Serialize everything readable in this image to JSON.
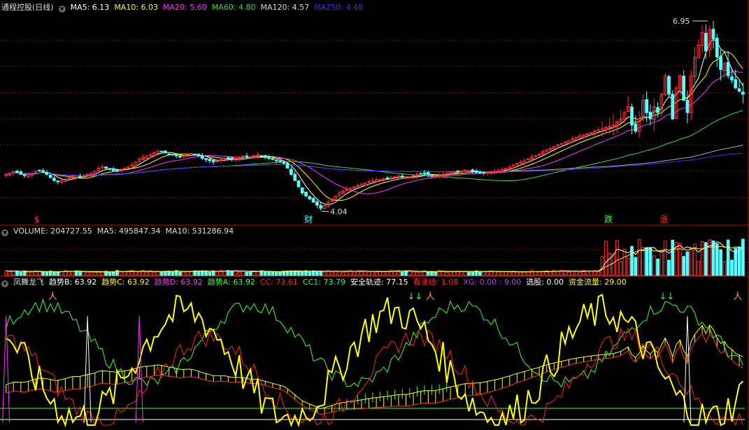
{
  "colors": {
    "background": "#000000",
    "grid": "#6a0d0d",
    "separator": "#b01010",
    "up": "#ff3030",
    "down": "#54ffff",
    "ma5": "#ffffff",
    "ma10": "#ffff00",
    "ma20": "#ff33ff",
    "ma60": "#33dd33",
    "ma120": "#aaaaaa",
    "ma250": "#3333ff",
    "trend_b": "#ffffff",
    "trend_c": "#ffff00",
    "trend_d": "#ff33ff",
    "trend_a": "#33ff33",
    "cc": "#ff2020",
    "cc1": "#33ff33",
    "safe": "#ffffff",
    "rise_line": "#ff2020",
    "xg": "#bb33ff",
    "select": "#ffffff",
    "funds": "#ffff00"
  },
  "price_panel": {
    "title": "通程控股(日线)",
    "indicators": [
      {
        "label": "MA5: 6.13",
        "color": "#ffffff"
      },
      {
        "label": "MA10: 6.03",
        "color": "#ffff00"
      },
      {
        "label": "MA20: 5.60",
        "color": "#ff33ff"
      },
      {
        "label": "MA60: 4.80",
        "color": "#33dd33"
      },
      {
        "label": "MA120: 4.57",
        "color": "#dddddd"
      },
      {
        "label": "MA250: 4.48",
        "color": "#3333ff"
      }
    ],
    "high_label": "6.95",
    "low_label": "4.04",
    "markers": [
      {
        "text": "$",
        "color": "#ff3030"
      },
      {
        "text": "财",
        "color": "#54ffff"
      },
      {
        "text": "跌",
        "color": "#33ff33"
      },
      {
        "text": "涨",
        "color": "#ff3030"
      }
    ]
  },
  "volume_panel": {
    "indicators": [
      {
        "label": "VOLUME: 204727.55",
        "color": "#dddddd"
      },
      {
        "label": "MA5: 495847.34",
        "color": "#dddddd"
      },
      {
        "label": "MA10: 531286.94",
        "color": "#dddddd"
      }
    ]
  },
  "indicator_panel": {
    "indicators": [
      {
        "label": "凤舞龙飞",
        "color": "#dddddd"
      },
      {
        "label": "趋势B: 63.92",
        "color": "#ffffff"
      },
      {
        "label": "趋势C: 63.92",
        "color": "#ffff00"
      },
      {
        "label": "趋势D: 63.92",
        "color": "#ff33ff"
      },
      {
        "label": "趋势A: 63.92",
        "color": "#33ff33"
      },
      {
        "label": "CC: 73.61",
        "color": "#ff2020"
      },
      {
        "label": "CC1: 73.79",
        "color": "#33ff33"
      },
      {
        "label": "安全轨迹: 77.15",
        "color": "#ffffff"
      },
      {
        "label": "看涨线: 1.08",
        "color": "#ff2020"
      },
      {
        "label": "XG: 0.00 : 9.00",
        "color": "#bb33ff"
      },
      {
        "label": "选股: 0.00",
        "color": "#ffffff"
      },
      {
        "label": "资金流量: 29.00",
        "color": "#ffff00"
      }
    ]
  },
  "chart_data": [
    {
      "type": "candlestick",
      "series": [
        {
          "name": "MA5",
          "value": 6.13
        },
        {
          "name": "MA10",
          "value": 6.03
        },
        {
          "name": "MA20",
          "value": 5.6
        },
        {
          "name": "MA60",
          "value": 4.8
        },
        {
          "name": "MA120",
          "value": 4.57
        },
        {
          "name": "MA250",
          "value": 4.48
        }
      ],
      "ylim": [
        3.8,
        7.2
      ],
      "bars": 205,
      "closes": [
        4.6,
        4.62,
        4.65,
        4.63,
        4.6,
        4.58,
        4.6,
        4.62,
        4.65,
        4.66,
        4.64,
        4.6,
        4.55,
        4.5,
        4.48,
        4.5,
        4.52,
        4.55,
        4.57,
        4.56,
        4.55,
        4.58,
        4.6,
        4.62,
        4.65,
        4.7,
        4.72,
        4.7,
        4.68,
        4.66,
        4.65,
        4.68,
        4.7,
        4.72,
        4.75,
        4.8,
        4.85,
        4.88,
        4.9,
        4.92,
        4.95,
        4.98,
        4.97,
        4.95,
        4.93,
        4.92,
        4.9,
        4.88,
        4.9,
        4.92,
        4.94,
        4.92,
        4.9,
        4.86,
        4.84,
        4.82,
        4.8,
        4.82,
        4.84,
        4.86,
        4.85,
        4.84,
        4.86,
        4.88,
        4.9,
        4.89,
        4.88,
        4.9,
        4.92,
        4.9,
        4.88,
        4.86,
        4.84,
        4.82,
        4.8,
        4.78,
        4.7,
        4.6,
        4.5,
        4.4,
        4.3,
        4.25,
        4.2,
        4.15,
        4.1,
        4.05,
        4.1,
        4.15,
        4.2,
        4.25,
        4.3,
        4.33,
        4.36,
        4.38,
        4.4,
        4.42,
        4.44,
        4.46,
        4.48,
        4.5,
        4.51,
        4.52,
        4.53,
        4.54,
        4.55,
        4.56,
        4.57,
        4.56,
        4.55,
        4.56,
        4.58,
        4.6,
        4.61,
        4.62,
        4.6,
        4.58,
        4.57,
        4.58,
        4.6,
        4.62,
        4.63,
        4.64,
        4.65,
        4.66,
        4.67,
        4.66,
        4.64,
        4.63,
        4.62,
        4.62,
        4.63,
        4.64,
        4.65,
        4.66,
        4.68,
        4.7,
        4.72,
        4.75,
        4.78,
        4.8,
        4.82,
        4.85,
        4.88,
        4.9,
        4.93,
        4.97,
        5.0,
        5.03,
        5.05,
        5.08,
        5.1,
        5.12,
        5.15,
        5.18,
        5.2,
        5.22,
        5.24,
        5.26,
        5.28,
        5.3,
        5.32,
        5.34,
        5.36,
        5.38,
        5.4,
        5.45,
        5.5,
        5.6,
        5.7,
        5.4,
        5.3,
        5.5,
        5.8,
        5.6,
        5.5,
        5.7,
        5.6,
        5.9,
        6.2,
        5.9,
        5.5,
        6.0,
        6.2,
        5.8,
        5.6,
        6.2,
        6.5,
        6.7,
        6.9,
        6.6,
        6.95,
        6.8,
        6.5,
        6.3,
        6.4,
        6.2,
        6.13,
        6.0,
        5.95,
        5.9
      ],
      "high": 6.95,
      "low": 4.04,
      "markers": [
        "$",
        "财",
        "跌",
        "涨"
      ]
    },
    {
      "type": "bar",
      "series": [
        {
          "name": "VOLUME",
          "value": 204727.55
        },
        {
          "name": "MA5",
          "value": 495847.34
        },
        {
          "name": "MA10",
          "value": 531286.94
        }
      ],
      "bars": 205
    },
    {
      "type": "line",
      "series": [
        {
          "name": "趋势B",
          "value": 63.92
        },
        {
          "name": "趋势C",
          "value": 63.92
        },
        {
          "name": "趋势D",
          "value": 63.92
        },
        {
          "name": "趋势A",
          "value": 63.92
        },
        {
          "name": "CC",
          "value": 73.61
        },
        {
          "name": "CC1",
          "value": 73.79
        },
        {
          "name": "安全轨迹",
          "value": 77.15
        },
        {
          "name": "看涨线",
          "value": 1.08
        },
        {
          "name": "XG",
          "value": 0.0
        },
        {
          "name": "选股",
          "value": 0.0
        },
        {
          "name": "资金流量",
          "value": 29.0
        }
      ],
      "ylim": [
        0,
        100
      ]
    }
  ]
}
